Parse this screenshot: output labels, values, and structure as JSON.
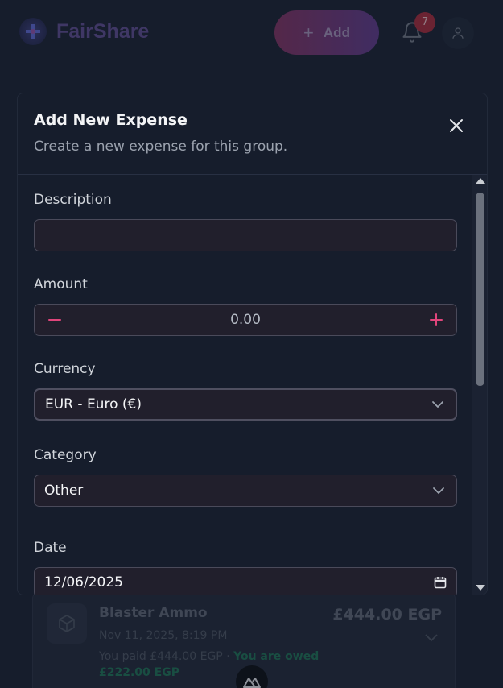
{
  "app": {
    "brand_name": "FairShare",
    "add_label": "Add",
    "notification_count": "7"
  },
  "background_expense": {
    "title": "Blaster Ammo",
    "date": "Nov 11, 2025, 8:19 PM",
    "paid_text": "You paid £444.00 EGP · ",
    "owed_text": "You are owed £222.00 EGP",
    "amount": "£444.00 EGP"
  },
  "modal": {
    "title": "Add New Expense",
    "subtitle": "Create a new expense for this group.",
    "fields": {
      "description": {
        "label": "Description",
        "value": "",
        "placeholder": ""
      },
      "amount": {
        "label": "Amount",
        "value": "0.00"
      },
      "currency": {
        "label": "Currency",
        "value": "EUR - Euro (€)"
      },
      "category": {
        "label": "Category",
        "value": "Other"
      },
      "date": {
        "label": "Date",
        "value": "12/06/2025"
      }
    }
  },
  "icons": {
    "close": "close-icon",
    "minus": "minus-icon",
    "plus": "plus-icon",
    "chevron": "chevron-down-icon",
    "calendar": "calendar-icon",
    "bell": "bell-icon",
    "user": "user-icon"
  },
  "colors": {
    "accent": "#e0457b",
    "modal_bg": "#161d2c",
    "input_bg": "#211f2c",
    "owed_green": "#1f6e55"
  }
}
